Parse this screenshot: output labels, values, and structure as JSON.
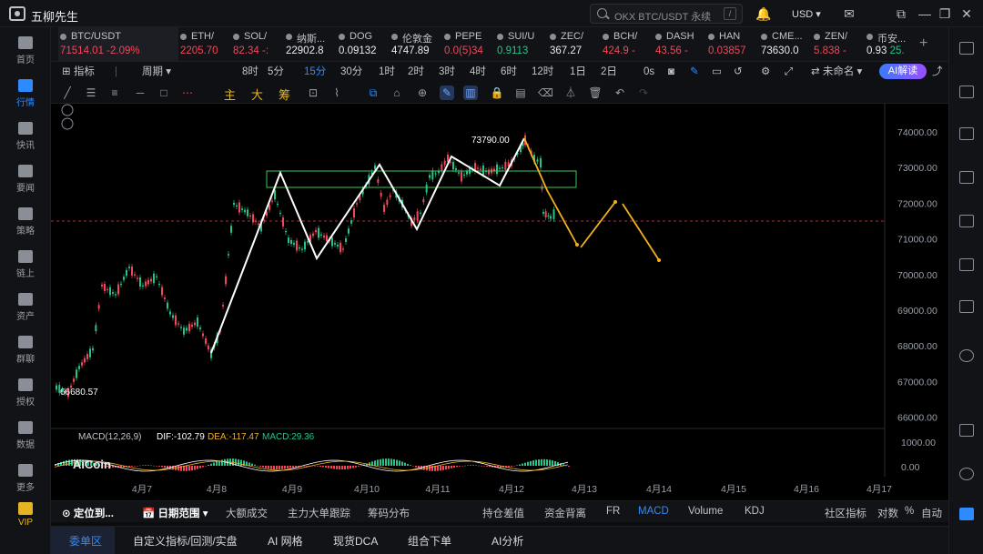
{
  "app": {
    "title": "五柳先生",
    "search_placeholder": "OKX BTC/USDT 永续",
    "search_key": "/",
    "currency": "USD"
  },
  "nav": [
    "首页",
    "行情",
    "快讯",
    "要闻",
    "策略",
    "链上",
    "资产",
    "群聊",
    "授权",
    "数据",
    "更多",
    "VIP"
  ],
  "tickers": [
    {
      "name": "BTC/USDT",
      "price": "71514.01",
      "change": "-2.09%",
      "dir": "neg",
      "active": true
    },
    {
      "name": "ETH/",
      "price": "2205.70",
      "change": "",
      "dir": "neg"
    },
    {
      "name": "SOL/",
      "price": "82.34",
      "change": "-:",
      "dir": "neg"
    },
    {
      "name": "纳斯...",
      "price": "22902.8",
      "change": "",
      "dir": "none"
    },
    {
      "name": "DOG",
      "price": "0.09132",
      "change": "",
      "dir": "none"
    },
    {
      "name": "伦敦金",
      "price": "4747.89",
      "change": "",
      "dir": "none"
    },
    {
      "name": "PEPE",
      "price": "0.0(5)34",
      "change": "",
      "dir": "neg"
    },
    {
      "name": "SUI/U",
      "price": "0.9113",
      "change": "",
      "dir": "pos"
    },
    {
      "name": "ZEC/",
      "price": "367.27",
      "change": "",
      "dir": "none"
    },
    {
      "name": "BCH/",
      "price": "424.9",
      "change": "-",
      "dir": "neg"
    },
    {
      "name": "DASH",
      "price": "43.56",
      "change": "-",
      "dir": "neg"
    },
    {
      "name": "HAN",
      "price": "0.03857",
      "change": "",
      "dir": "neg"
    },
    {
      "name": "CME...",
      "price": "73630.0",
      "change": "",
      "dir": "none"
    },
    {
      "name": "ZEN/",
      "price": "5.838",
      "change": "-",
      "dir": "neg"
    },
    {
      "name": "币安...",
      "price": "0.93",
      "change": "25.",
      "dir": "none"
    }
  ],
  "timeframes": {
    "indicator": "指标",
    "period": "周期",
    "items": [
      "8时",
      "5分",
      "15分",
      "30分",
      "1时",
      "2时",
      "3时",
      "4时",
      "6时",
      "12时",
      "1日",
      "2日"
    ],
    "active": "15分",
    "extra": "0s",
    "layout": "未命名",
    "ai": "AI解读"
  },
  "draw_text": {
    "zhu": "主",
    "da": "大",
    "chou": "筹"
  },
  "chart_data": {
    "type": "candlestick",
    "symbol": "BTC/USDT",
    "y_ticks": [
      "74000.00",
      "73000.00",
      "72000.00",
      "71000.00",
      "70000.00",
      "69000.00",
      "68000.00",
      "67000.00",
      "66000.00"
    ],
    "x_ticks": [
      "4月7",
      "4月8",
      "4月9",
      "4月10",
      "4月11",
      "4月12",
      "4月13",
      "4月14",
      "4月15",
      "4月16",
      "4月17"
    ],
    "high_label": "73790.00",
    "low_label": "66680.57",
    "current_price": "71514.01",
    "macd_label": "MACD(12,26,9)",
    "dif": "DIF:-102.79",
    "dea": "DEA:-117.47",
    "macd": "MACD:29.36",
    "macd_ticks": [
      "1000.00",
      "0.00"
    ],
    "watermark": "AiCoin"
  },
  "indicator_tabs": {
    "locate": "定位到...",
    "range": "日期范围",
    "items": [
      "大额成交",
      "主力大单跟踪",
      "筹码分布",
      "持仓差值",
      "资金背离",
      "FR",
      "MACD",
      "Volume",
      "KDJ",
      "社区指标",
      "对数",
      "%",
      "自动"
    ],
    "active": "MACD"
  },
  "bottom_tabs": [
    "委单区",
    "自定义指标/回测/实盘",
    "AI 网格",
    "现货DCA",
    "组合下单",
    "AI分析"
  ],
  "colors": {
    "accent": "#2e8bff",
    "up": "#25c48a",
    "down": "#f0485a",
    "forecast": "#f2b01e"
  }
}
